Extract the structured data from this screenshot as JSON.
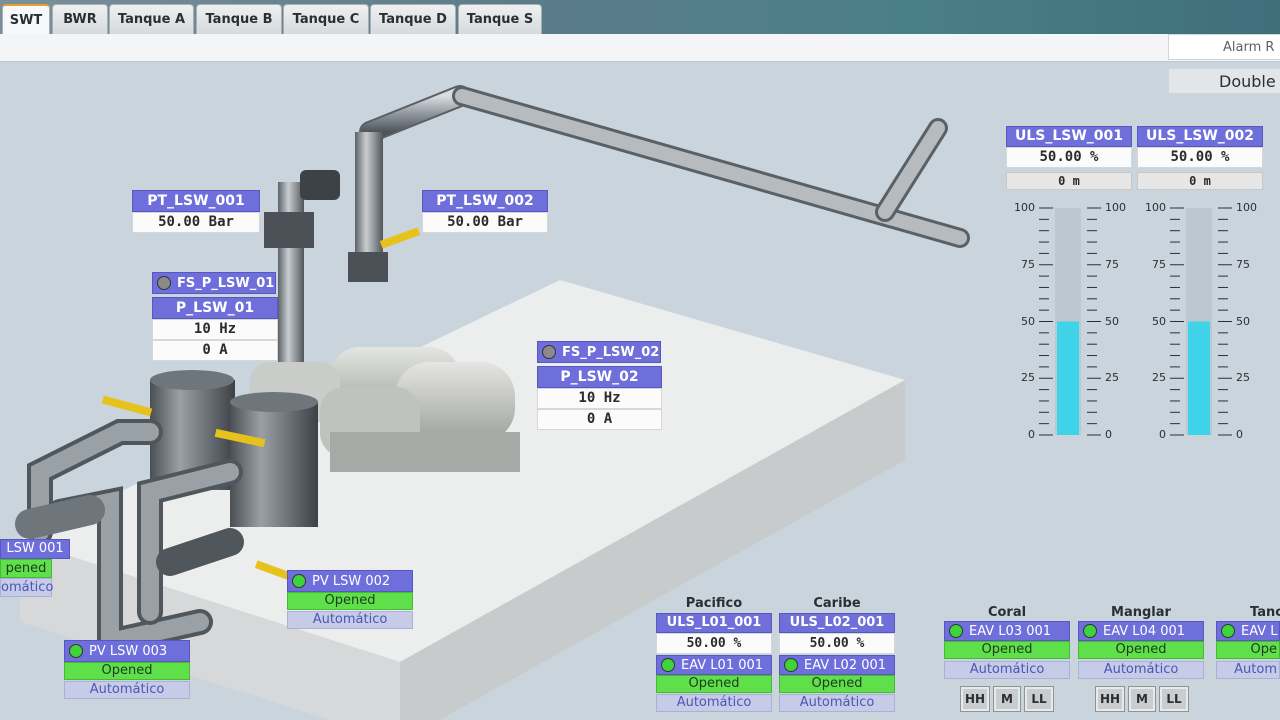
{
  "tabs": [
    {
      "label": "SWT",
      "active": true
    },
    {
      "label": "BWR",
      "active": false
    },
    {
      "label": "Tanque A",
      "active": false
    },
    {
      "label": "Tanque B",
      "active": false
    },
    {
      "label": "Tanque C",
      "active": false
    },
    {
      "label": "Tanque D",
      "active": false
    },
    {
      "label": "Tanque S",
      "active": false
    }
  ],
  "header": {
    "alarm_label": "Alarm R",
    "double_label": "Double"
  },
  "pt1": {
    "name": "PT_LSW_001",
    "value": "50.00 Bar"
  },
  "pt2": {
    "name": "PT_LSW_002",
    "value": "50.00 Bar"
  },
  "pump1": {
    "fs": "FS_P_LSW_01",
    "name": "P_LSW_01",
    "freq": "10 Hz",
    "current": "0 A"
  },
  "pump2": {
    "fs": "FS_P_LSW_02",
    "name": "P_LSW_02",
    "freq": "10 Hz",
    "current": "0 A"
  },
  "pv1": {
    "name": "LSW 001",
    "state": "pened",
    "mode": "omático"
  },
  "pv2": {
    "name": "PV LSW 002",
    "state": "Opened",
    "mode": "Automático"
  },
  "pv3": {
    "name": "PV LSW 003",
    "state": "Opened",
    "mode": "Automático"
  },
  "uls1": {
    "name": "ULS_LSW_001",
    "pct": "50.00 %",
    "m": "0 m",
    "level": 0.5
  },
  "uls2": {
    "name": "ULS_LSW_002",
    "pct": "50.00 %",
    "m": "0 m",
    "level": 0.5
  },
  "scale_ticks": [
    "100",
    "75",
    "50",
    "25",
    "0"
  ],
  "pacifico": {
    "title": "Pacifico",
    "uls": "ULS_L01_001",
    "pct": "50.00 %",
    "eav": "EAV L01 001",
    "state": "Opened",
    "mode": "Automático"
  },
  "caribe": {
    "title": "Caribe",
    "uls": "ULS_L02_001",
    "pct": "50.00 %",
    "eav": "EAV L02 001",
    "state": "Opened",
    "mode": "Automático"
  },
  "coral": {
    "title": "Coral",
    "eav": "EAV L03 001",
    "state": "Opened",
    "mode": "Automático"
  },
  "manglar": {
    "title": "Manglar",
    "eav": "EAV L04 001",
    "state": "Opened",
    "mode": "Automático"
  },
  "tanq": {
    "title": "Tanc",
    "eav": "EAV L",
    "state": "Ope",
    "mode": "Autom"
  },
  "level_buttons": {
    "hh": "HH",
    "m": "M",
    "ll": "LL"
  },
  "colors": {
    "header": "#6f6fdc",
    "opened": "#5fe04a",
    "auto": "#c6cbe8",
    "level": "#3fd3ea"
  }
}
